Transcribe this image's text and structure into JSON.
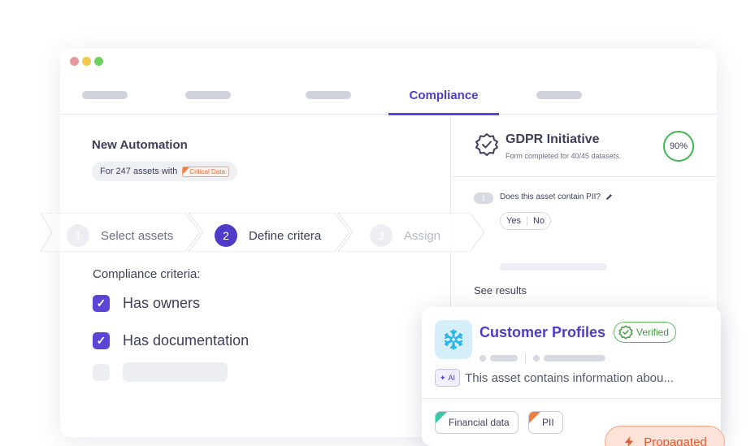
{
  "window": {
    "tabs": [
      {
        "label": "",
        "placeholder": true
      },
      {
        "label": "",
        "placeholder": true
      },
      {
        "label": "",
        "placeholder": true
      },
      {
        "label": "Compliance",
        "active": true
      },
      {
        "label": "",
        "placeholder": true
      }
    ]
  },
  "automation": {
    "title": "New Automation",
    "scope_text": "For 247 assets with",
    "scope_tag": "Critical Data"
  },
  "stepper": {
    "steps": [
      {
        "number": "1",
        "label": "Select assets",
        "state": "done"
      },
      {
        "number": "2",
        "label": "Define critera",
        "state": "active"
      },
      {
        "number": "3",
        "label": "Assign",
        "state": "pending"
      }
    ]
  },
  "criteria": {
    "label": "Compliance criteria:",
    "items": [
      {
        "label": "Has owners",
        "checked": true
      },
      {
        "label": "Has documentation",
        "checked": true
      }
    ]
  },
  "gdpr": {
    "title": "GDPR Initiative",
    "subtitle": "Form completed for 40/45 datasets.",
    "percent": "90%",
    "question_number": "1",
    "question": "Does this asset contain PII?",
    "yes": "Yes",
    "no": "No",
    "see_results": "See results"
  },
  "asset_card": {
    "title": "Customer Profiles",
    "verified": "Verified",
    "ai_badge": "AI",
    "ai_summary": "This asset contains information abou...",
    "tags": [
      {
        "label": "Financial data",
        "color": "#3cc8a8"
      },
      {
        "label": "PII",
        "color": "#f07b3f"
      }
    ],
    "propagated": "Propagated"
  },
  "colors": {
    "accent": "#5a45d6",
    "verified_green": "#3fb950",
    "propagated_orange": "#e4572e"
  }
}
